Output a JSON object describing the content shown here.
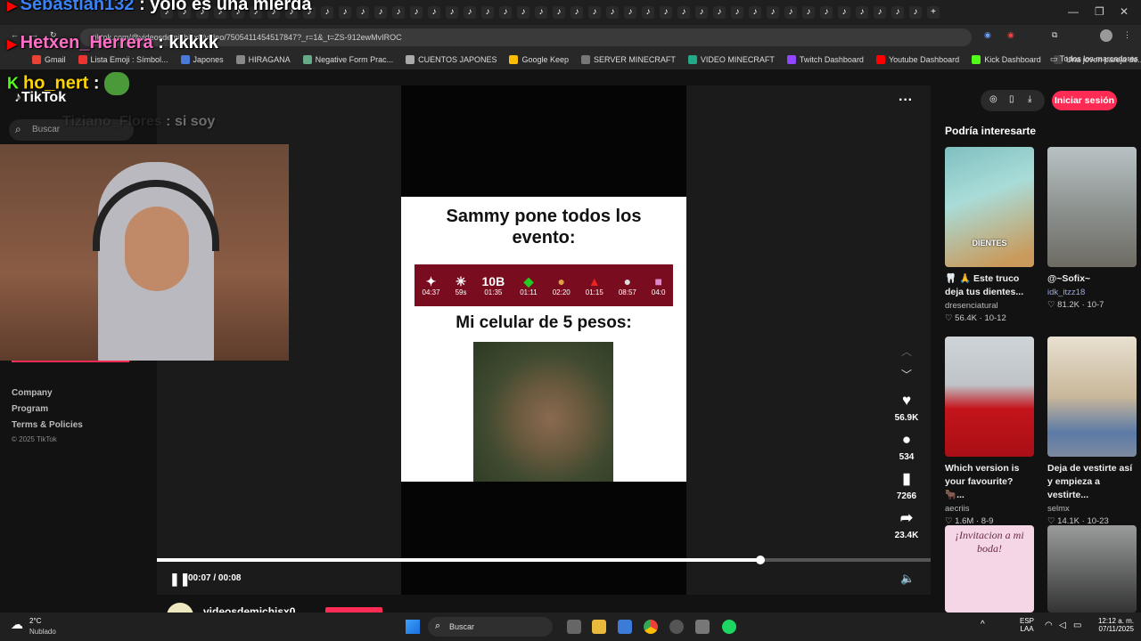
{
  "browser": {
    "url": "tiktok.com/@videosdemichisx0/video/7505411454517847?_r=1&_t=ZS-912ewMvIROC",
    "bookmarks": [
      "Gmail",
      "Lista Emoji : Símbol...",
      "Japones",
      "HIRAGANA",
      "Negative Form Prac...",
      "CUENTOS JAPONES",
      "Google Keep",
      "SERVER MINECRAFT",
      "VIDEO MINECRAFT",
      "Twitch Dashboard",
      "Youtube Dashboard",
      "Kick Dashboard",
      "Una joven pareja de..."
    ],
    "all_bookmarks": "Todos los marcadores"
  },
  "stream_chat": [
    {
      "user": "Sebastian132",
      "message": "yolo es una mierda",
      "color": "#3b82f6"
    },
    {
      "user": "Hetxen_Herrera",
      "message": "kkkkk",
      "color": "#ff6ec7"
    },
    {
      "user": "ho_nert",
      "message": "",
      "color": "#ffd400"
    },
    {
      "user": "Tiziano_Flores",
      "message": "si soy",
      "color": "#444444"
    }
  ],
  "tiktok": {
    "logo": "TikTok",
    "search_placeholder": "Buscar",
    "sidebar_footer": [
      "Company",
      "Program",
      "Terms & Policies"
    ],
    "copyright": "© 2025 TikTok",
    "login": "Iniciar sesión",
    "more": "···",
    "meme": {
      "top_text": "Sammy pone todos los evento:",
      "bottom_text": "Mi celular de 5 pesos:",
      "timers": [
        "04:37",
        "59s",
        "01:35",
        "01:11",
        "02:20",
        "01:15",
        "08:57",
        "04:0"
      ],
      "label_10b": "10B"
    },
    "actions": {
      "likes": "56.9K",
      "comments": "534",
      "saves": "7266",
      "shares": "23.4K"
    },
    "player": {
      "time": "00:07 / 00:08",
      "progress": 0.78
    },
    "author": "videosdemichisx0",
    "recommend_title": "Podría interesarte",
    "cards": [
      {
        "title": "🦷 🙏 Este truco deja tus dientes...",
        "author": "dresenciatural",
        "likes": "56.4K",
        "date": "10-12",
        "overlay": "DIENTES"
      },
      {
        "title": "@~Sofix~",
        "author": "idk_itzz18",
        "likes": "81.2K",
        "date": "10-7",
        "overlay": ""
      },
      {
        "title": "Which version is your favourite? 🐂...",
        "author": "aecriis",
        "likes": "1.6M",
        "date": "8-9",
        "overlay": ""
      },
      {
        "title": "Deja de vestirte así y empieza a vestirte...",
        "author": "selmx",
        "likes": "14.1K",
        "date": "10-23",
        "overlay": ""
      },
      {
        "title": "",
        "author": "",
        "likes": "",
        "date": "",
        "overlay": "¡Invitacion a mi boda!"
      },
      {
        "title": "",
        "author": "",
        "likes": "",
        "date": "",
        "overlay": ""
      }
    ]
  },
  "taskbar": {
    "weather_temp": "2°C",
    "weather_desc": "Nublado",
    "search": "Buscar",
    "lang": "ESP",
    "lang2": "LAA",
    "time": "12:12 a. m.",
    "date": "07/11/2025"
  }
}
